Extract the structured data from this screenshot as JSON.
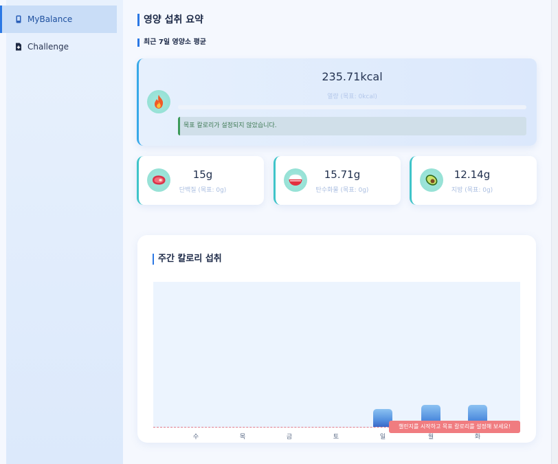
{
  "sidebar": {
    "items": [
      {
        "label": "MyBalance",
        "icon": "mobile-icon",
        "active": true
      },
      {
        "label": "Challenge",
        "icon": "file-plus-icon",
        "active": false
      }
    ]
  },
  "summary": {
    "title": "영양 섭취 요약",
    "subtitle": "최근 7일 영양소 평균"
  },
  "calories": {
    "icon": "fire-icon",
    "value": "235.71kcal",
    "target_label": "열량 (목표: 0kcal)",
    "progress": 0,
    "alert": "목표 칼로리가 설정되지 않았습니다."
  },
  "macros": [
    {
      "icon": "meat-icon",
      "value": "15g",
      "label": "단백질 (목표: 0g)"
    },
    {
      "icon": "rice-icon",
      "value": "15.71g",
      "label": "탄수화물 (목표: 0g)"
    },
    {
      "icon": "avocado-icon",
      "value": "12.14g",
      "label": "지방 (목표: 0g)"
    }
  ],
  "weekly": {
    "title": "주간 칼로리 섭취",
    "toast": "챌린지를 시작하고 목표 칼로리를 설정해 보세요!"
  },
  "chart_data": {
    "type": "bar",
    "categories": [
      "수",
      "목",
      "금",
      "토",
      "일",
      "월",
      "화"
    ],
    "values": [
      0,
      0,
      0,
      0,
      0.8,
      1.0,
      1.0
    ],
    "title": "주간 칼로리 섭취",
    "xlabel": "",
    "ylabel": "",
    "grid": false,
    "colors": {
      "bar_top": "#8cc2f2",
      "bar_bottom": "#3a68c8",
      "target_line": "#e07a8a"
    }
  }
}
